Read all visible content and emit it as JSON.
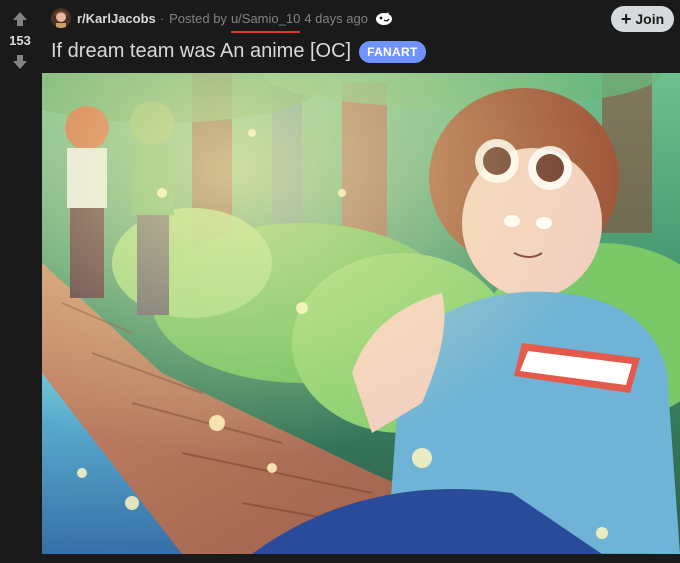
{
  "vote": {
    "count": "153"
  },
  "meta": {
    "subreddit": "r/KarlJacobs",
    "separator": "·",
    "posted_by": "Posted by",
    "username": "u/Samio_10",
    "time": "4 days ago"
  },
  "join_button": {
    "label": "Join"
  },
  "post": {
    "title": "If dream team was An anime [OC]",
    "flair": "FANART"
  },
  "colors": {
    "background": "#1a1a1b",
    "text": "#d7dadc",
    "muted": "#818384",
    "flair": "#7193ff",
    "username_underline": "#e0322b"
  },
  "icons": [
    "upvote-icon",
    "downvote-icon",
    "subreddit-avatar-icon",
    "award-icon",
    "plus-icon"
  ]
}
